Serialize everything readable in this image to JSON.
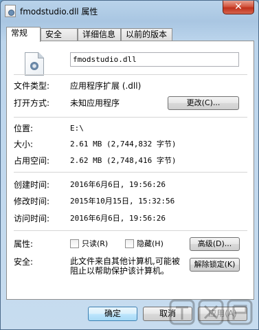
{
  "window": {
    "title": "fmodstudio.dll 属性",
    "close_glyph": "✕"
  },
  "tabs": [
    {
      "label": "常规",
      "active": true
    },
    {
      "label": "安全",
      "active": false
    },
    {
      "label": "详细信息",
      "active": false
    },
    {
      "label": "以前的版本",
      "active": false
    }
  ],
  "general": {
    "file_name": "fmodstudio.dll",
    "type_label": "文件类型:",
    "type_value": "应用程序扩展 (.dll)",
    "opens_label": "打开方式:",
    "opens_value": "未知应用程序",
    "change_button": "更改(C)...",
    "location_label": "位置:",
    "location_value": "E:\\",
    "size_label": "大小:",
    "size_value": "2.61 MB (2,744,832 字节)",
    "size_on_disk_label": "占用空间:",
    "size_on_disk_value": "2.62 MB (2,748,416 字节)",
    "created_label": "创建时间:",
    "created_value": "2016年6月6日, 19:56:26",
    "modified_label": "修改时间:",
    "modified_value": "2015年10月15日, 15:32:56",
    "accessed_label": "访问时间:",
    "accessed_value": "2016年6月6日, 19:56:26",
    "attributes_label": "属性:",
    "readonly_label": "只读(R)",
    "readonly_checked": false,
    "hidden_label": "隐藏(H)",
    "hidden_checked": false,
    "advanced_button": "高级(D)...",
    "security_label": "安全:",
    "security_text": "此文件来自其他计算机,可能被阻止以帮助保护该计算机。",
    "unblock_button": "解除锁定(K)"
  },
  "footer": {
    "ok_button": "确定",
    "cancel_button": "取消",
    "apply_button": "应用(A)"
  },
  "watermark": {
    "brand": "下载吧"
  }
}
